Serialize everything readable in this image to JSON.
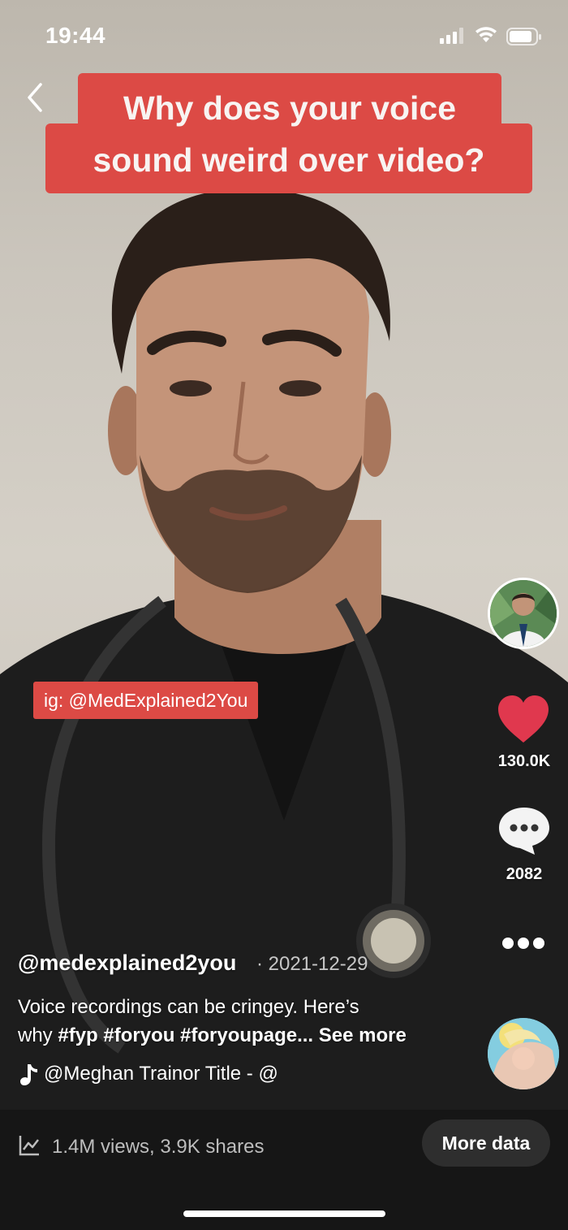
{
  "status_bar": {
    "time": "19:44"
  },
  "video": {
    "title_line1": "Why does your voice",
    "title_line2": "sound weird over video?",
    "ig_label": "ig: @MedExplained2You"
  },
  "actions": {
    "like_count": "130.0K",
    "comment_count": "2082"
  },
  "post": {
    "username": "@medexplained2you",
    "date": "· 2021-12-29",
    "caption_text_1": "Voice recordings can be cringey. Here’s",
    "caption_text_2": "why ",
    "hashtags": "#fyp #foryou #foryoupage...",
    "see_more": "See more",
    "music": "@Meghan Trainor    Title - @"
  },
  "footer": {
    "stats": "1.4M views, 3.9K shares",
    "more_data_label": "More data"
  },
  "colors": {
    "accent_red": "#dc4a45",
    "like_red": "#e0384e",
    "bar_bg": "#161616"
  }
}
